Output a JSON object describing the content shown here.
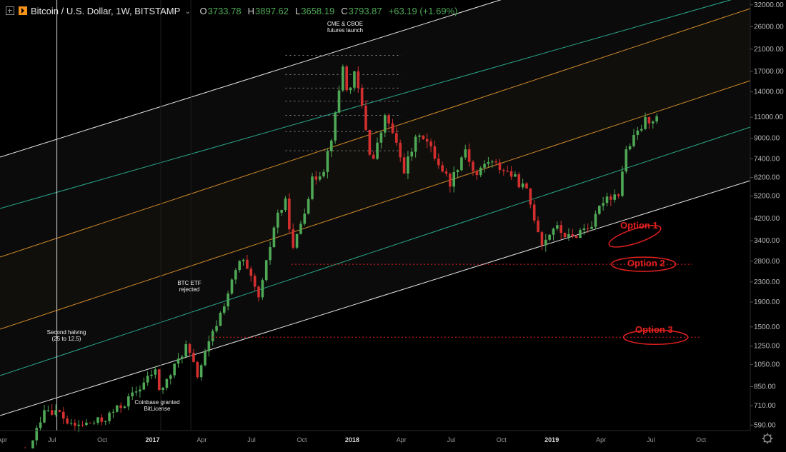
{
  "header": {
    "title": "Bitcoin / U.S. Dollar, 1W, BITSTAMP",
    "open_label": "O",
    "open": "3733.78",
    "high_label": "H",
    "high": "3897.62",
    "low_label": "L",
    "low": "3658.19",
    "close_label": "C",
    "close": "3793.87",
    "change": "+63.19 (+1.69%)"
  },
  "price_axis": {
    "ticks": [
      "32000.00",
      "26000.00",
      "21000.00",
      "17000.00",
      "14000.00",
      "11000.00",
      "9000.00",
      "7400.00",
      "6200.00",
      "5200.00",
      "4200.00",
      "3400.00",
      "2800.00",
      "2300.00",
      "1900.00",
      "1500.00",
      "1250.00",
      "1050.00",
      "850.00",
      "710.00",
      "590.00"
    ]
  },
  "time_axis": {
    "ticks": [
      {
        "label": "Apr",
        "t": "2016-04"
      },
      {
        "label": "Jul",
        "t": "2016-07"
      },
      {
        "label": "Oct",
        "t": "2016-10"
      },
      {
        "label": "2017",
        "t": "2017-01"
      },
      {
        "label": "Apr",
        "t": "2017-04"
      },
      {
        "label": "Jul",
        "t": "2017-07"
      },
      {
        "label": "Oct",
        "t": "2017-10"
      },
      {
        "label": "2018",
        "t": "2018-01"
      },
      {
        "label": "Apr",
        "t": "2018-04"
      },
      {
        "label": "Jul",
        "t": "2018-07"
      },
      {
        "label": "Oct",
        "t": "2018-10"
      },
      {
        "label": "2019",
        "t": "2019-01"
      },
      {
        "label": "Apr",
        "t": "2019-04"
      },
      {
        "label": "Jul",
        "t": "2019-07"
      },
      {
        "label": "Oct",
        "t": "2019-10"
      }
    ]
  },
  "annotations": [
    {
      "lines": [
        "CME & CBOE",
        "futures launch"
      ]
    },
    {
      "lines": [
        "BTC ETF",
        "rejected"
      ]
    },
    {
      "lines": [
        "Second halving",
        "(25 to 12.5)"
      ]
    },
    {
      "lines": [
        "Coinbase granted",
        "BitLicense"
      ]
    }
  ],
  "options": [
    {
      "label": "Option 1"
    },
    {
      "label": "Option 2"
    },
    {
      "label": "Option 3"
    }
  ],
  "chart_data": {
    "type": "candlestick",
    "scale": "log",
    "symbol": "BTCUSD",
    "interval": "1W",
    "x_range": [
      "2016-03-28",
      "2019-12-30"
    ],
    "y_range": [
      560,
      33500
    ],
    "colors": {
      "up": "#4ea856",
      "down": "#d32f2f",
      "background": "#000000",
      "orange_channel": "#d08a2a",
      "teal_channel": "#2aa88a",
      "white_channel": "#e8e8e8",
      "option_red": "#e02020",
      "vertical_marker": "#d8d8d8"
    },
    "anchors": [
      [
        "2016-04-01",
        420
      ],
      [
        "2016-05-20",
        450
      ],
      [
        "2016-06-17",
        700
      ],
      [
        "2016-07-15",
        660
      ],
      [
        "2016-08-05",
        580
      ],
      [
        "2016-10-01",
        615
      ],
      [
        "2016-11-15",
        740
      ],
      [
        "2016-12-20",
        900
      ],
      [
        "2017-01-05",
        1000
      ],
      [
        "2017-01-15",
        800
      ],
      [
        "2017-03-03",
        1250
      ],
      [
        "2017-03-24",
        950
      ],
      [
        "2017-05-20",
        2100
      ],
      [
        "2017-06-12",
        2900
      ],
      [
        "2017-07-15",
        1950
      ],
      [
        "2017-08-15",
        4300
      ],
      [
        "2017-09-02",
        4900
      ],
      [
        "2017-09-15",
        3100
      ],
      [
        "2017-10-20",
        6000
      ],
      [
        "2017-11-10",
        6800
      ],
      [
        "2017-11-28",
        10000
      ],
      [
        "2017-12-17",
        19500
      ],
      [
        "2017-12-22",
        14000
      ],
      [
        "2018-01-06",
        16500
      ],
      [
        "2018-01-21",
        11500
      ],
      [
        "2018-02-06",
        7000
      ],
      [
        "2018-03-04",
        11300
      ],
      [
        "2018-04-06",
        6700
      ],
      [
        "2018-05-05",
        9700
      ],
      [
        "2018-06-29",
        5900
      ],
      [
        "2018-07-27",
        8200
      ],
      [
        "2018-08-14",
        6200
      ],
      [
        "2018-09-05",
        7300
      ],
      [
        "2018-10-15",
        6500
      ],
      [
        "2018-11-15",
        5500
      ],
      [
        "2018-12-15",
        3300
      ],
      [
        "2019-01-05",
        3900
      ],
      [
        "2019-02-05",
        3450
      ],
      [
        "2019-02-25",
        3800
      ],
      [
        "2019-03-18",
        4000
      ],
      [
        "2019-04-01",
        4800
      ],
      [
        "2019-04-08",
        5200
      ],
      [
        "2019-04-22",
        5200
      ],
      [
        "2019-05-05",
        5400
      ],
      [
        "2019-05-14",
        7800
      ],
      [
        "2019-06-22",
        10700
      ],
      [
        "2019-07-15",
        11000
      ]
    ],
    "levels": [
      {
        "price": 19800,
        "from": "2017-09-01",
        "to": "2018-04-01"
      },
      {
        "price": 16500,
        "from": "2017-09-01",
        "to": "2018-04-01"
      },
      {
        "price": 14500,
        "from": "2017-09-01",
        "to": "2018-04-01"
      },
      {
        "price": 12800,
        "from": "2017-09-01",
        "to": "2018-04-01"
      },
      {
        "price": 11200,
        "from": "2017-09-01",
        "to": "2018-04-01"
      },
      {
        "price": 9600,
        "from": "2017-09-01",
        "to": "2018-04-01"
      },
      {
        "price": 8000,
        "from": "2017-09-01",
        "to": "2018-04-01"
      }
    ],
    "option_levels": [
      {
        "label": "Option 1",
        "price": 3550
      },
      {
        "label": "Option 2",
        "price": 2720
      },
      {
        "label": "Option 3",
        "price": 1360
      }
    ]
  }
}
